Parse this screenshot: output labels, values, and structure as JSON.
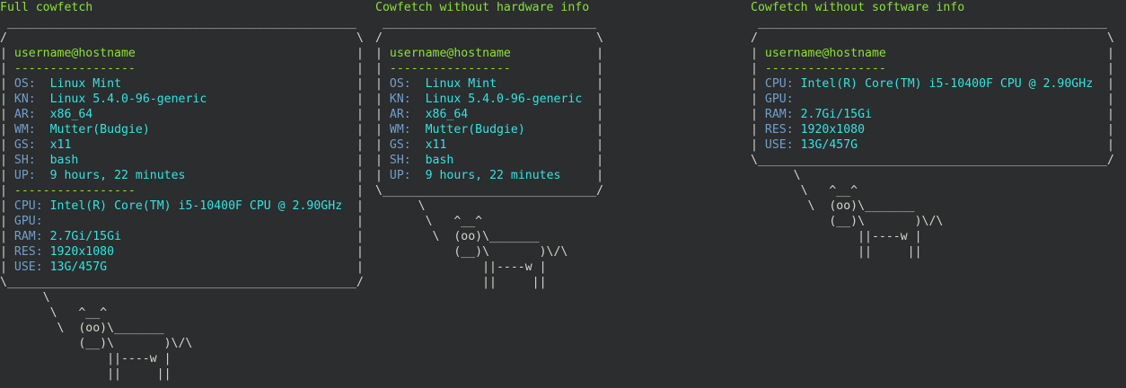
{
  "colors": {
    "background": "#2b2d2e",
    "title": "#8ae234",
    "user": "#8ae234",
    "label": "#729fcf",
    "value": "#34e2e2",
    "frame": "#d3d7cf"
  },
  "panels": [
    {
      "title": "Full cowfetch",
      "user": "username@hostname",
      "separator": "-----------------",
      "sections": [
        [
          {
            "label": "OS:",
            "value": "Linux Mint"
          },
          {
            "label": "KN:",
            "value": "Linux 5.4.0-96-generic"
          },
          {
            "label": "AR:",
            "value": "x86_64"
          },
          {
            "label": "WM:",
            "value": "Mutter(Budgie)"
          },
          {
            "label": "GS:",
            "value": "x11"
          },
          {
            "label": "SH:",
            "value": "bash"
          },
          {
            "label": "UP:",
            "value": "9 hours, 22 minutes"
          }
        ],
        [
          {
            "label": "CPU:",
            "value": "Intel(R) Core(TM) i5-10400F CPU @ 2.90GHz"
          },
          {
            "label": "GPU:",
            "value": ""
          },
          {
            "label": "RAM:",
            "value": "2.7Gi/15Gi"
          },
          {
            "label": "RES:",
            "value": "1920x1080"
          },
          {
            "label": "USE:",
            "value": "13G/457G"
          }
        ]
      ]
    },
    {
      "title": "Cowfetch without hardware info",
      "user": "username@hostname",
      "separator": "-----------------",
      "sections": [
        [
          {
            "label": "OS:",
            "value": "Linux Mint"
          },
          {
            "label": "KN:",
            "value": "Linux 5.4.0-96-generic"
          },
          {
            "label": "AR:",
            "value": "x86_64"
          },
          {
            "label": "WM:",
            "value": "Mutter(Budgie)"
          },
          {
            "label": "GS:",
            "value": "x11"
          },
          {
            "label": "SH:",
            "value": "bash"
          },
          {
            "label": "UP:",
            "value": "9 hours, 22 minutes"
          }
        ]
      ]
    },
    {
      "title": "Cowfetch without software info",
      "user": "username@hostname",
      "separator": "-----------------",
      "sections": [
        [
          {
            "label": "CPU:",
            "value": "Intel(R) Core(TM) i5-10400F CPU @ 2.90GHz"
          },
          {
            "label": "GPU:",
            "value": ""
          },
          {
            "label": "RAM:",
            "value": "2.7Gi/15Gi"
          },
          {
            "label": "RES:",
            "value": "1920x1080"
          },
          {
            "label": "USE:",
            "value": "13G/457G"
          }
        ]
      ]
    }
  ],
  "cow": [
    "\\   ^__^",
    "\\  (oo)\\_______",
    "(__)\\       )\\/\\",
    "||----w |",
    "||     ||"
  ]
}
